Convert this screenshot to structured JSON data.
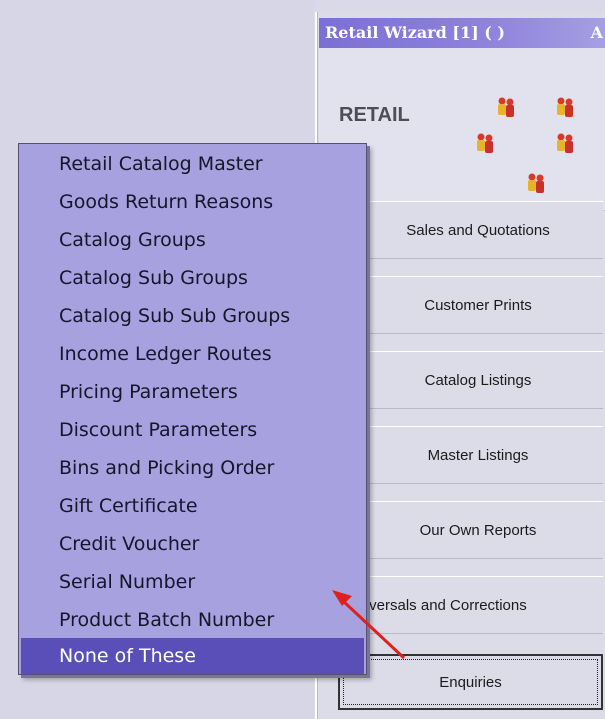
{
  "wizard": {
    "title": "Retail Wizard [1]   ( )",
    "title_extra": "A",
    "heading": "RETAIL",
    "buttons": [
      {
        "label": "Sales and Quotations"
      },
      {
        "label": "Customer Prints"
      },
      {
        "label": "Catalog Listings"
      },
      {
        "label": "Master Listings"
      },
      {
        "label": "Our Own Reports"
      },
      {
        "label": "Reversals and Corrections"
      },
      {
        "label": "Enquiries"
      }
    ],
    "focused_button": "Enquiries"
  },
  "popup_menu": {
    "items": [
      {
        "label": "Retail Catalog Master"
      },
      {
        "label": "Goods Return Reasons"
      },
      {
        "label": "Catalog Groups"
      },
      {
        "label": "Catalog Sub Groups"
      },
      {
        "label": "Catalog Sub Sub Groups"
      },
      {
        "label": "Income Ledger Routes"
      },
      {
        "label": "Pricing Parameters"
      },
      {
        "label": "Discount Parameters"
      },
      {
        "label": "Bins and Picking Order"
      },
      {
        "label": "Gift Certificate"
      },
      {
        "label": "Credit Voucher"
      },
      {
        "label": "Serial Number"
      },
      {
        "label": "Product Batch Number"
      },
      {
        "label": "None of These"
      }
    ],
    "selected_item": "None of These"
  },
  "colors": {
    "menu_bg": "#a8a1e0",
    "menu_selected": "#5a4fb8",
    "title_bar": "#7c6fd3",
    "annotation_arrow": "#e0201c"
  },
  "icons": {
    "people": "people-group-icon",
    "annotation": "red-arrow-icon"
  }
}
